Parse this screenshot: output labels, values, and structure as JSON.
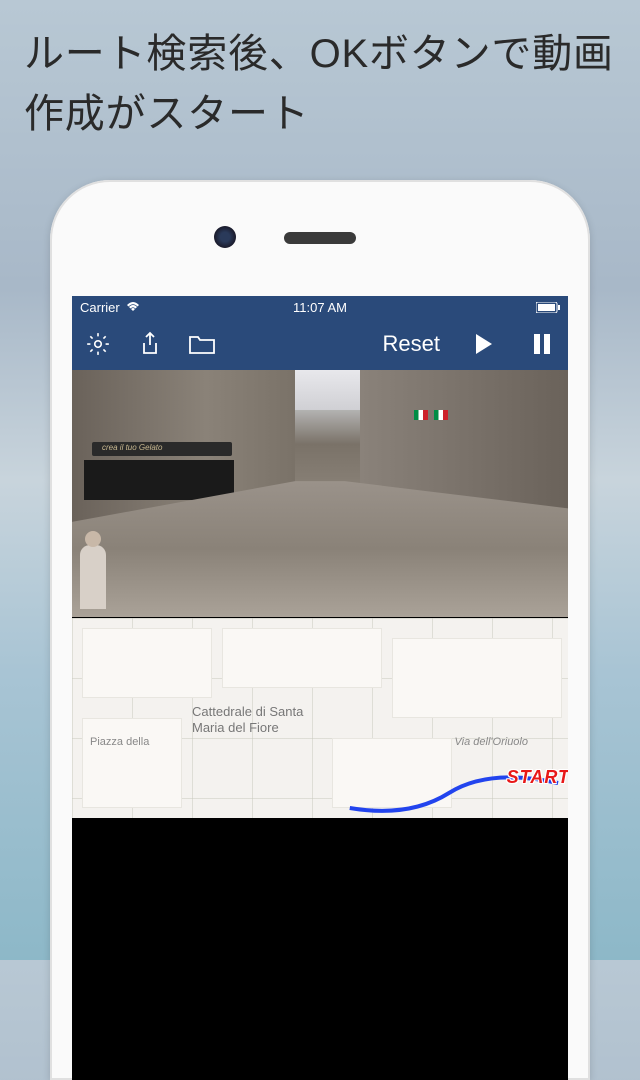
{
  "headline": "ルート検索後、OKボタンで動画作成がスタート",
  "status_bar": {
    "carrier": "Carrier",
    "time": "11:07 AM"
  },
  "toolbar": {
    "settings_icon": "gear",
    "share_icon": "share",
    "folder_icon": "folder",
    "reset_label": "Reset",
    "play_icon": "play",
    "pause_icon": "pause"
  },
  "street_view": {
    "store_sign": "crea il tuo Gelato",
    "flags": [
      "italy",
      "italy"
    ]
  },
  "map": {
    "landmark_name": "Cattedrale di Santa\nMaria del Fiore",
    "street_name": "Via dell'Oriuolo",
    "minor_label": "Piazza della",
    "start_label": "START",
    "route_color": "#2244ee"
  }
}
